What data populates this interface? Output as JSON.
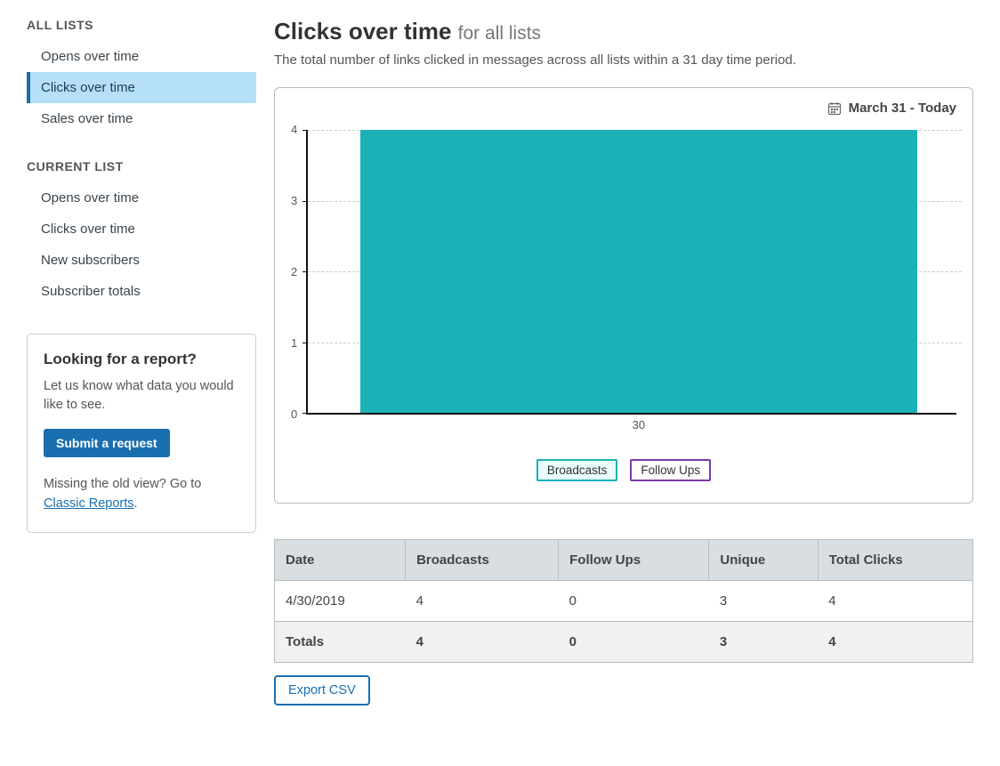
{
  "sidebar": {
    "groups": [
      {
        "heading": "ALL LISTS",
        "items": [
          {
            "label": "Opens over time",
            "active": false
          },
          {
            "label": "Clicks over time",
            "active": true
          },
          {
            "label": "Sales over time",
            "active": false
          }
        ]
      },
      {
        "heading": "CURRENT LIST",
        "items": [
          {
            "label": "Opens over time",
            "active": false
          },
          {
            "label": "Clicks over time",
            "active": false
          },
          {
            "label": "New subscribers",
            "active": false
          },
          {
            "label": "Subscriber totals",
            "active": false
          }
        ]
      }
    ],
    "promo": {
      "title": "Looking for a report?",
      "text": "Let us know what data you would like to see.",
      "button_label": "Submit a request",
      "after_text_1": "Missing the old view? Go to ",
      "after_link": "Classic Reports",
      "after_text_2": "."
    }
  },
  "header": {
    "title_main": "Clicks over time",
    "title_sub": "for all lists",
    "description": "The total number of links clicked in messages across all lists within a 31 day time period."
  },
  "chart": {
    "date_range_label": "March 31 - Today",
    "legend": {
      "broadcasts": "Broadcasts",
      "followups": "Follow Ups"
    }
  },
  "chart_data": {
    "type": "bar",
    "categories": [
      "30"
    ],
    "series": [
      {
        "name": "Broadcasts",
        "color": "#1bb1b6",
        "values": [
          4
        ]
      },
      {
        "name": "Follow Ups",
        "color": "#7a3aa8",
        "values": [
          0
        ]
      }
    ],
    "ylim": [
      0,
      4
    ],
    "yticks": [
      0,
      1,
      2,
      3,
      4
    ],
    "xlabel": "",
    "ylabel": "",
    "title": ""
  },
  "table": {
    "columns": [
      "Date",
      "Broadcasts",
      "Follow Ups",
      "Unique",
      "Total Clicks"
    ],
    "rows": [
      {
        "cells": [
          "4/30/2019",
          "4",
          "0",
          "3",
          "4"
        ],
        "totals": false
      },
      {
        "cells": [
          "Totals",
          "4",
          "0",
          "3",
          "4"
        ],
        "totals": true
      }
    ]
  },
  "export_label": "Export CSV"
}
